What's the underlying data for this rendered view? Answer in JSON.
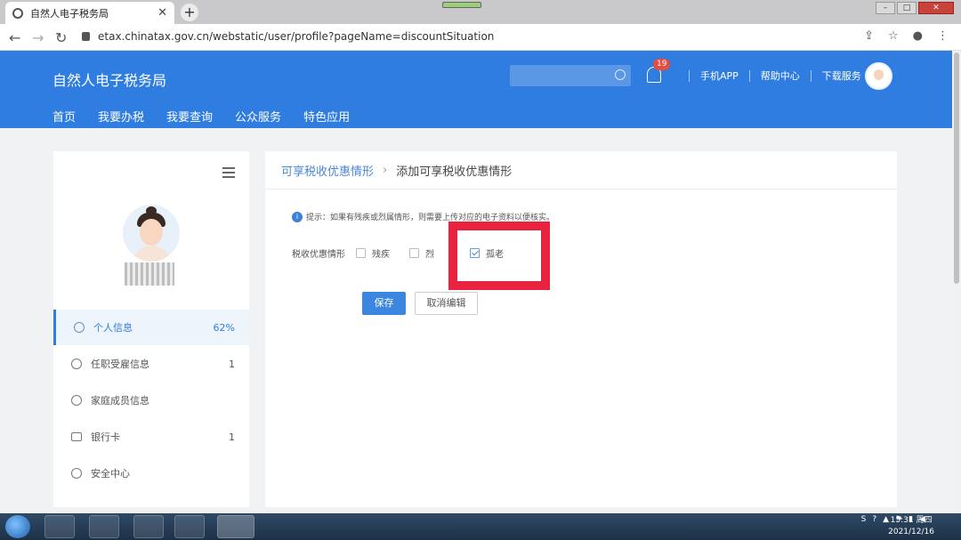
{
  "browser": {
    "tab_title": "自然人电子税务局",
    "url": "etax.chinatax.gov.cn/webstatic/user/profile?pageName=discountSituation"
  },
  "header": {
    "brand": "自然人电子税务局",
    "notification_count": "19",
    "links": [
      "手机APP",
      "帮助中心",
      "下载服务"
    ],
    "menu": [
      "首页",
      "我要办税",
      "我要查询",
      "公众服务",
      "特色应用"
    ],
    "accent_color": "#2f7de0"
  },
  "sidebar": {
    "items": [
      {
        "label": "个人信息",
        "value": "62%",
        "icon": "user-icon"
      },
      {
        "label": "任职受雇信息",
        "value": "1",
        "icon": "employment-icon"
      },
      {
        "label": "家庭成员信息",
        "value": "",
        "icon": "family-icon"
      },
      {
        "label": "银行卡",
        "value": "1",
        "icon": "bank-card-icon"
      },
      {
        "label": "安全中心",
        "value": "",
        "icon": "shield-icon"
      }
    ]
  },
  "main": {
    "breadcrumb_parent": "可享税收优惠情形",
    "breadcrumb_sep": "›",
    "breadcrumb_current": "添加可享税收优惠情形",
    "hint": "提示：如果有残疾或烈属情形，则需要上传对应的电子资料以便核实。",
    "form_label": "税收优惠情形",
    "options": [
      {
        "label": "残疾",
        "checked": false
      },
      {
        "label": "烈",
        "checked": false
      },
      {
        "label": "孤老",
        "checked": true
      }
    ],
    "save_label": "保存",
    "cancel_label": "取消编辑"
  },
  "taskbar": {
    "time": "15:31 周四",
    "date": "2021/12/16"
  }
}
